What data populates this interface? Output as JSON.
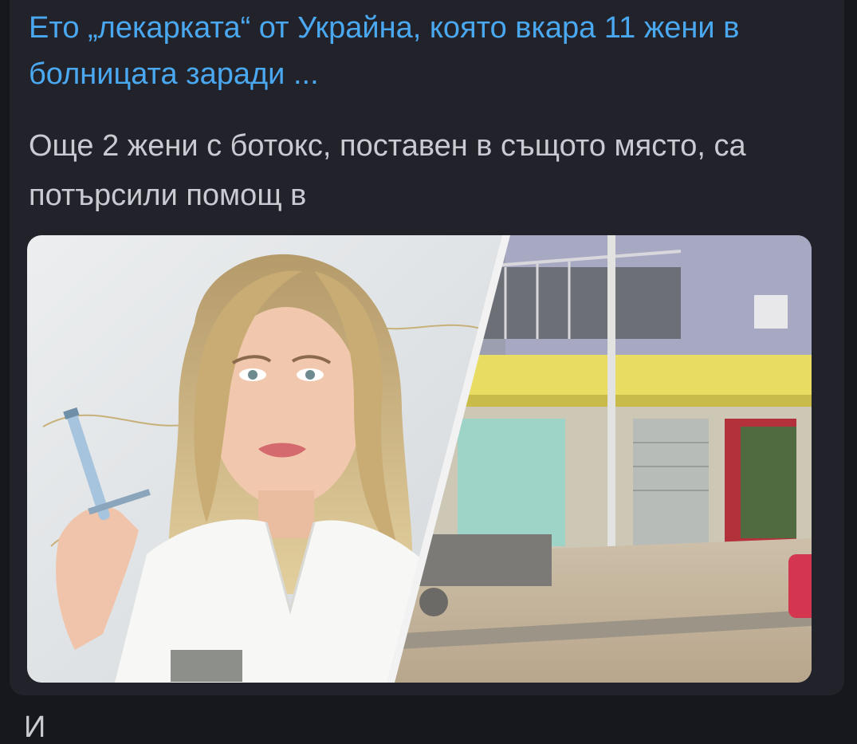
{
  "link_preview": {
    "title": "Ето „лекарката“ от Украйна, която вкара 11 жени в болницата заради ...",
    "description": "Още 2 жени с ботокс, поставен в същото място, са потърсили помощ в"
  },
  "next_message": {
    "text": "И"
  },
  "colors": {
    "background": "#17181d",
    "card": "#22232a",
    "title_link": "#4aa8f0",
    "description": "#c9cbd2"
  }
}
